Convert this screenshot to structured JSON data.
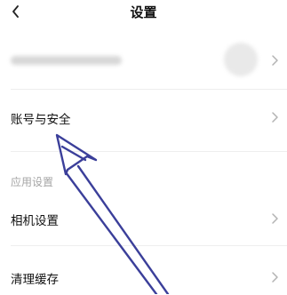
{
  "header": {
    "title": "设置",
    "back_icon": "chevron-left-icon"
  },
  "settings": {
    "account_security": "账号与安全",
    "section_app_settings": "应用设置",
    "camera_settings": "相机设置",
    "clear_cache": "清理缓存"
  },
  "icons": {
    "row_chevron": "chevron-right-icon"
  },
  "colors": {
    "annotation_arrow": "#3b3f9a",
    "section_header_text": "#a5a5a5",
    "divider": "#eeeeee"
  }
}
